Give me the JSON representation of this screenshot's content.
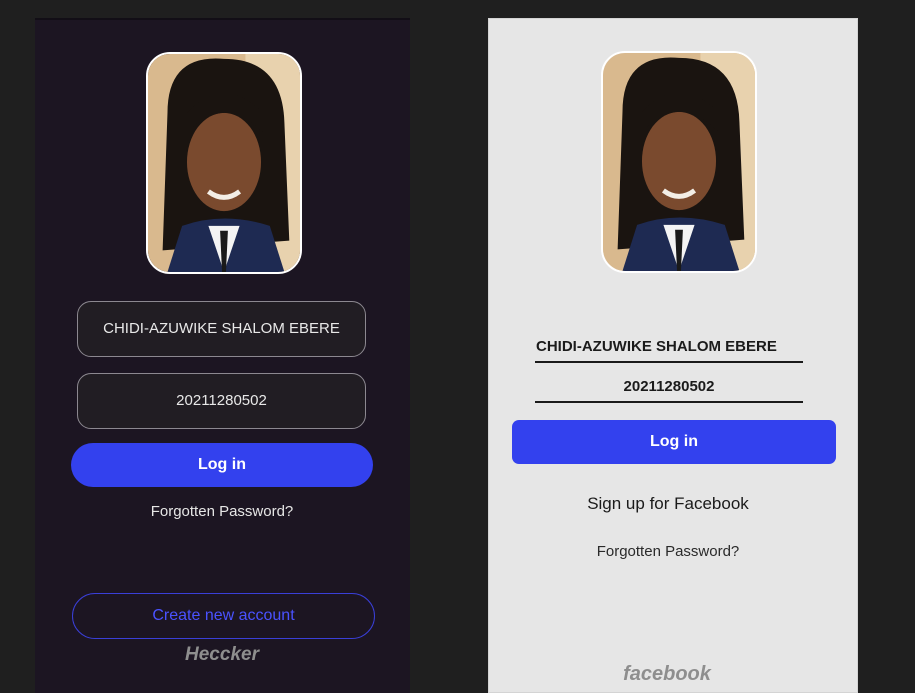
{
  "dark_screen": {
    "name_field": "CHIDI-AZUWIKE SHALOM  EBERE",
    "password_field": "20211280502",
    "login_button": "Log in",
    "forgot_link": "Forgotten Password?",
    "create_account_button": "Create new account",
    "brand": "Heccker"
  },
  "light_screen": {
    "name_field": "CHIDI-AZUWIKE SHALOM  EBERE",
    "password_field": "20211280502",
    "login_button": "Log in",
    "signup_link": "Sign up for Facebook",
    "forgot_link": "Forgotten Password?",
    "brand": "facebook"
  },
  "colors": {
    "dark_background": "#1c1522",
    "light_background": "#e6e6e6",
    "accent": "#3341ee"
  }
}
